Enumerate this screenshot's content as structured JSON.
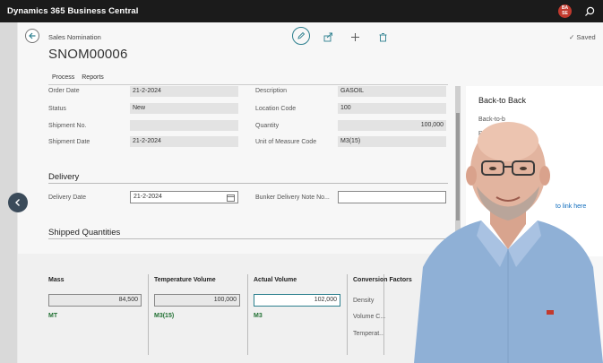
{
  "app": {
    "title": "Dynamics 365 Business Central",
    "avatar_initials": "BA\nSE"
  },
  "page": {
    "breadcrumb": "Sales Nomination",
    "title": "SNOM00006",
    "saved": "Saved",
    "tabs": [
      "Process",
      "Reports"
    ]
  },
  "general": {
    "order_date": {
      "label": "Order Date",
      "value": "21-2-2024"
    },
    "status": {
      "label": "Status",
      "value": "New"
    },
    "shipment_no": {
      "label": "Shipment No.",
      "value": ""
    },
    "shipment_date": {
      "label": "Shipment Date",
      "value": "21-2-2024"
    },
    "description": {
      "label": "Description",
      "value": "GASOIL"
    },
    "location_code": {
      "label": "Location Code",
      "value": "100"
    },
    "quantity": {
      "label": "Quantity",
      "value": "100,000"
    },
    "uom_code": {
      "label": "Unit of Measure Code",
      "value": "M3(15)"
    }
  },
  "delivery": {
    "title": "Delivery",
    "delivery_date": {
      "label": "Delivery Date",
      "value": "21-2-2024"
    },
    "bunker_note": {
      "label": "Bunker Delivery Note No...",
      "value": ""
    }
  },
  "shipped": {
    "title": "Shipped Quantities",
    "mass": {
      "label": "Mass",
      "value": "84,500",
      "unit": "MT"
    },
    "temp_volume": {
      "label": "Temperature Volume",
      "value": "100,000",
      "unit": "M3(15)"
    },
    "actual_volume": {
      "label": "Actual Volume",
      "value": "102,000",
      "unit": "M3"
    },
    "conversion": {
      "label": "Conversion Factors",
      "rows": [
        "Density",
        "Volume C...",
        "Temperat..."
      ]
    }
  },
  "factbox": {
    "title": "Back-to Back",
    "rows": [
      "Back-to-b",
      "Purc",
      "Ve"
    ],
    "link": "to link here"
  }
}
